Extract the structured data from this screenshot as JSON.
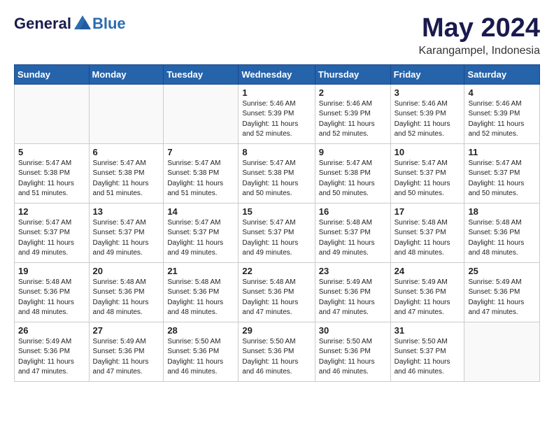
{
  "header": {
    "logo_general": "General",
    "logo_blue": "Blue",
    "month_title": "May 2024",
    "location": "Karangampel, Indonesia"
  },
  "weekdays": [
    "Sunday",
    "Monday",
    "Tuesday",
    "Wednesday",
    "Thursday",
    "Friday",
    "Saturday"
  ],
  "weeks": [
    [
      {
        "day": "",
        "info": ""
      },
      {
        "day": "",
        "info": ""
      },
      {
        "day": "",
        "info": ""
      },
      {
        "day": "1",
        "info": "Sunrise: 5:46 AM\nSunset: 5:39 PM\nDaylight: 11 hours\nand 52 minutes."
      },
      {
        "day": "2",
        "info": "Sunrise: 5:46 AM\nSunset: 5:39 PM\nDaylight: 11 hours\nand 52 minutes."
      },
      {
        "day": "3",
        "info": "Sunrise: 5:46 AM\nSunset: 5:39 PM\nDaylight: 11 hours\nand 52 minutes."
      },
      {
        "day": "4",
        "info": "Sunrise: 5:46 AM\nSunset: 5:39 PM\nDaylight: 11 hours\nand 52 minutes."
      }
    ],
    [
      {
        "day": "5",
        "info": "Sunrise: 5:47 AM\nSunset: 5:38 PM\nDaylight: 11 hours\nand 51 minutes."
      },
      {
        "day": "6",
        "info": "Sunrise: 5:47 AM\nSunset: 5:38 PM\nDaylight: 11 hours\nand 51 minutes."
      },
      {
        "day": "7",
        "info": "Sunrise: 5:47 AM\nSunset: 5:38 PM\nDaylight: 11 hours\nand 51 minutes."
      },
      {
        "day": "8",
        "info": "Sunrise: 5:47 AM\nSunset: 5:38 PM\nDaylight: 11 hours\nand 50 minutes."
      },
      {
        "day": "9",
        "info": "Sunrise: 5:47 AM\nSunset: 5:38 PM\nDaylight: 11 hours\nand 50 minutes."
      },
      {
        "day": "10",
        "info": "Sunrise: 5:47 AM\nSunset: 5:37 PM\nDaylight: 11 hours\nand 50 minutes."
      },
      {
        "day": "11",
        "info": "Sunrise: 5:47 AM\nSunset: 5:37 PM\nDaylight: 11 hours\nand 50 minutes."
      }
    ],
    [
      {
        "day": "12",
        "info": "Sunrise: 5:47 AM\nSunset: 5:37 PM\nDaylight: 11 hours\nand 49 minutes."
      },
      {
        "day": "13",
        "info": "Sunrise: 5:47 AM\nSunset: 5:37 PM\nDaylight: 11 hours\nand 49 minutes."
      },
      {
        "day": "14",
        "info": "Sunrise: 5:47 AM\nSunset: 5:37 PM\nDaylight: 11 hours\nand 49 minutes."
      },
      {
        "day": "15",
        "info": "Sunrise: 5:47 AM\nSunset: 5:37 PM\nDaylight: 11 hours\nand 49 minutes."
      },
      {
        "day": "16",
        "info": "Sunrise: 5:48 AM\nSunset: 5:37 PM\nDaylight: 11 hours\nand 49 minutes."
      },
      {
        "day": "17",
        "info": "Sunrise: 5:48 AM\nSunset: 5:37 PM\nDaylight: 11 hours\nand 48 minutes."
      },
      {
        "day": "18",
        "info": "Sunrise: 5:48 AM\nSunset: 5:36 PM\nDaylight: 11 hours\nand 48 minutes."
      }
    ],
    [
      {
        "day": "19",
        "info": "Sunrise: 5:48 AM\nSunset: 5:36 PM\nDaylight: 11 hours\nand 48 minutes."
      },
      {
        "day": "20",
        "info": "Sunrise: 5:48 AM\nSunset: 5:36 PM\nDaylight: 11 hours\nand 48 minutes."
      },
      {
        "day": "21",
        "info": "Sunrise: 5:48 AM\nSunset: 5:36 PM\nDaylight: 11 hours\nand 48 minutes."
      },
      {
        "day": "22",
        "info": "Sunrise: 5:48 AM\nSunset: 5:36 PM\nDaylight: 11 hours\nand 47 minutes."
      },
      {
        "day": "23",
        "info": "Sunrise: 5:49 AM\nSunset: 5:36 PM\nDaylight: 11 hours\nand 47 minutes."
      },
      {
        "day": "24",
        "info": "Sunrise: 5:49 AM\nSunset: 5:36 PM\nDaylight: 11 hours\nand 47 minutes."
      },
      {
        "day": "25",
        "info": "Sunrise: 5:49 AM\nSunset: 5:36 PM\nDaylight: 11 hours\nand 47 minutes."
      }
    ],
    [
      {
        "day": "26",
        "info": "Sunrise: 5:49 AM\nSunset: 5:36 PM\nDaylight: 11 hours\nand 47 minutes."
      },
      {
        "day": "27",
        "info": "Sunrise: 5:49 AM\nSunset: 5:36 PM\nDaylight: 11 hours\nand 47 minutes."
      },
      {
        "day": "28",
        "info": "Sunrise: 5:50 AM\nSunset: 5:36 PM\nDaylight: 11 hours\nand 46 minutes."
      },
      {
        "day": "29",
        "info": "Sunrise: 5:50 AM\nSunset: 5:36 PM\nDaylight: 11 hours\nand 46 minutes."
      },
      {
        "day": "30",
        "info": "Sunrise: 5:50 AM\nSunset: 5:36 PM\nDaylight: 11 hours\nand 46 minutes."
      },
      {
        "day": "31",
        "info": "Sunrise: 5:50 AM\nSunset: 5:37 PM\nDaylight: 11 hours\nand 46 minutes."
      },
      {
        "day": "",
        "info": ""
      }
    ]
  ]
}
